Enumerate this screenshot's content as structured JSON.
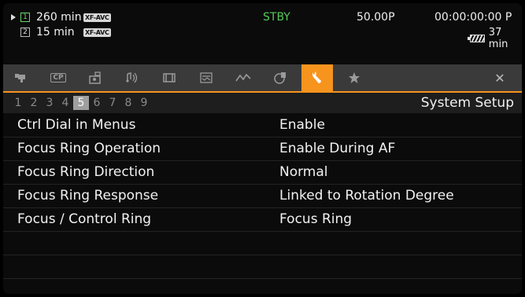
{
  "status": {
    "slots": [
      {
        "number": "1",
        "minutes": "260 min",
        "format": "XF-AVC",
        "active": true
      },
      {
        "number": "2",
        "minutes": "15 min",
        "format": "XF-AVC",
        "active": false
      }
    ],
    "mode": "STBY",
    "frame_rate": "50.00P",
    "timecode": "00:00:00:00 P",
    "battery_minutes": "37 min"
  },
  "tabs": [
    {
      "icon": "camera-icon"
    },
    {
      "icon": "custom-picture-icon",
      "label": "CP"
    },
    {
      "icon": "recording-setup-icon"
    },
    {
      "icon": "audio-icon"
    },
    {
      "icon": "video-setup-icon"
    },
    {
      "icon": "lcd-vf-setup-icon"
    },
    {
      "icon": "assistance-functions-icon"
    },
    {
      "icon": "network-icon"
    },
    {
      "icon": "wrench-icon",
      "active": true
    },
    {
      "icon": "star-icon"
    },
    {
      "icon": "close-icon",
      "label": "✕"
    }
  ],
  "pages": [
    "1",
    "2",
    "3",
    "4",
    "5",
    "6",
    "7",
    "8",
    "9"
  ],
  "current_page": "5",
  "section_title": "System Setup",
  "settings": [
    {
      "label": "Ctrl Dial in Menus",
      "value": "Enable"
    },
    {
      "label": "Focus Ring Operation",
      "value": "Enable During AF"
    },
    {
      "label": "Focus Ring Direction",
      "value": "Normal"
    },
    {
      "label": "Focus Ring Response",
      "value": "Linked to Rotation Degree"
    },
    {
      "label": "Focus / Control Ring",
      "value": "Focus Ring"
    },
    {
      "label": "",
      "value": ""
    },
    {
      "label": "",
      "value": ""
    },
    {
      "label": "",
      "value": ""
    }
  ],
  "colors": {
    "accent": "#f7941d",
    "standby": "#57c957",
    "slot_active": "#6cd36c"
  }
}
